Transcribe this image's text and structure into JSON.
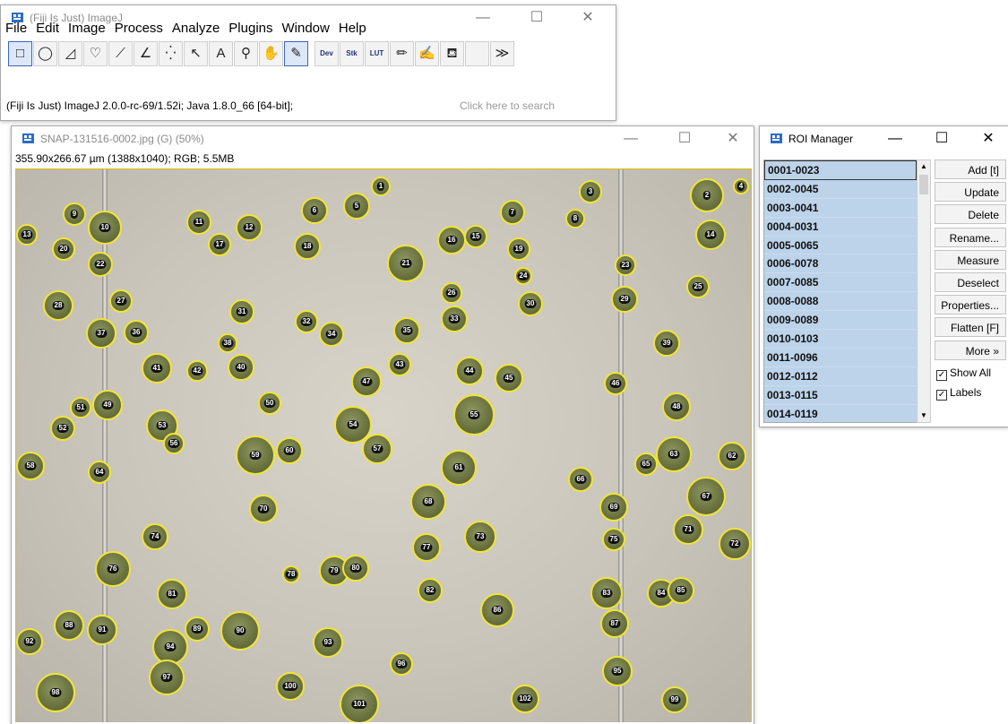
{
  "imagej": {
    "title": "(Fiji Is Just) ImageJ",
    "menu": [
      "File",
      "Edit",
      "Image",
      "Process",
      "Analyze",
      "Plugins",
      "Window",
      "Help"
    ],
    "tools": [
      {
        "name": "rectangle-tool-icon",
        "glyph": "□",
        "selected": true
      },
      {
        "name": "oval-tool-icon",
        "glyph": "◯"
      },
      {
        "name": "polygon-tool-icon",
        "glyph": "◿"
      },
      {
        "name": "freehand-tool-icon",
        "glyph": "♡"
      },
      {
        "name": "line-tool-icon",
        "glyph": "⟋",
        "tri": true
      },
      {
        "name": "angle-tool-icon",
        "glyph": "∠"
      },
      {
        "name": "point-tool-icon",
        "glyph": "⁛",
        "tri": true
      },
      {
        "name": "wand-tool-icon",
        "glyph": "↖"
      },
      {
        "name": "text-tool-icon",
        "glyph": "A"
      },
      {
        "name": "zoom-tool-icon",
        "glyph": "⚲"
      },
      {
        "name": "hand-tool-icon",
        "glyph": "✋"
      },
      {
        "name": "color-picker-icon",
        "glyph": "✎",
        "selected": true
      },
      {
        "name": "dev-menu-icon",
        "glyph": "Dev",
        "txt": true,
        "tri": true
      },
      {
        "name": "stk-menu-icon",
        "glyph": "Stk",
        "txt": true,
        "tri": true
      },
      {
        "name": "lut-menu-icon",
        "glyph": "LUT",
        "txt": true,
        "tri": true
      },
      {
        "name": "pencil-tool-icon",
        "glyph": "✏"
      },
      {
        "name": "brush-tool-icon",
        "glyph": "✍"
      },
      {
        "name": "flood-fill-icon",
        "glyph": "⛾"
      },
      {
        "name": "empty-tool-slot",
        "glyph": ""
      },
      {
        "name": "more-tools-icon",
        "glyph": "≫"
      }
    ],
    "status": "(Fiji Is Just) ImageJ 2.0.0-rc-69/1.52i; Java 1.8.0_66 [64-bit];",
    "search_placeholder": "Click here to search"
  },
  "image_window": {
    "title": "SNAP-131516-0002.jpg (G) (50%)",
    "info": "355.90x266.67 µm (1388x1040); RGB; 5.5MB",
    "cells": [
      [
        "1",
        396,
        8,
        22
      ],
      [
        "2",
        752,
        10,
        38
      ],
      [
        "3",
        628,
        12,
        26
      ],
      [
        "4",
        800,
        10,
        18
      ],
      [
        "5",
        365,
        26,
        30
      ],
      [
        "6",
        318,
        31,
        30
      ],
      [
        "7",
        540,
        34,
        28
      ],
      [
        "8",
        613,
        44,
        22
      ],
      [
        "9",
        52,
        37,
        26
      ],
      [
        "10",
        80,
        46,
        38
      ],
      [
        "11",
        190,
        45,
        28
      ],
      [
        "12",
        245,
        50,
        30
      ],
      [
        "13",
        0,
        61,
        24
      ],
      [
        "14",
        758,
        56,
        34
      ],
      [
        "15",
        500,
        62,
        26
      ],
      [
        "16",
        470,
        63,
        32
      ],
      [
        "17",
        214,
        71,
        26
      ],
      [
        "18",
        310,
        71,
        30
      ],
      [
        "19",
        548,
        76,
        26
      ],
      [
        "20",
        40,
        76,
        26
      ],
      [
        "21",
        414,
        84,
        42
      ],
      [
        "22",
        80,
        92,
        28
      ],
      [
        "23",
        668,
        95,
        24
      ],
      [
        "24",
        556,
        109,
        20
      ],
      [
        "25",
        748,
        118,
        26
      ],
      [
        "26",
        474,
        126,
        24
      ],
      [
        "27",
        104,
        134,
        26
      ],
      [
        "28",
        30,
        135,
        34
      ],
      [
        "29",
        664,
        130,
        30
      ],
      [
        "30",
        560,
        136,
        28
      ],
      [
        "31",
        238,
        145,
        28
      ],
      [
        "32",
        311,
        157,
        26
      ],
      [
        "33",
        474,
        152,
        30
      ],
      [
        "34",
        338,
        170,
        28
      ],
      [
        "35",
        421,
        165,
        30
      ],
      [
        "36",
        120,
        168,
        28
      ],
      [
        "37",
        78,
        166,
        34
      ],
      [
        "38",
        225,
        183,
        22
      ],
      [
        "39",
        711,
        179,
        30
      ],
      [
        "40",
        236,
        206,
        30
      ],
      [
        "41",
        140,
        205,
        34
      ],
      [
        "42",
        190,
        213,
        24
      ],
      [
        "43",
        415,
        205,
        26
      ],
      [
        "44",
        490,
        209,
        32
      ],
      [
        "45",
        534,
        217,
        32
      ],
      [
        "46",
        656,
        226,
        26
      ],
      [
        "47",
        374,
        220,
        34
      ],
      [
        "48",
        721,
        249,
        32
      ],
      [
        "49",
        85,
        246,
        34
      ],
      [
        "50",
        270,
        248,
        26
      ],
      [
        "51",
        60,
        254,
        24
      ],
      [
        "52",
        38,
        275,
        28
      ],
      [
        "53",
        145,
        268,
        36
      ],
      [
        "54",
        355,
        264,
        42
      ],
      [
        "55",
        488,
        251,
        46
      ],
      [
        "56",
        164,
        294,
        24
      ],
      [
        "57",
        386,
        295,
        34
      ],
      [
        "58",
        0,
        315,
        32
      ],
      [
        "59",
        245,
        297,
        44
      ],
      [
        "60",
        290,
        299,
        30
      ],
      [
        "61",
        474,
        313,
        40
      ],
      [
        "62",
        783,
        304,
        32
      ],
      [
        "63",
        714,
        298,
        40
      ],
      [
        "64",
        80,
        325,
        26
      ],
      [
        "65",
        690,
        316,
        26
      ],
      [
        "66",
        616,
        332,
        28
      ],
      [
        "67",
        748,
        343,
        44
      ],
      [
        "68",
        440,
        351,
        40
      ],
      [
        "69",
        651,
        361,
        32
      ],
      [
        "70",
        260,
        363,
        32
      ],
      [
        "71",
        733,
        385,
        34
      ],
      [
        "72",
        784,
        400,
        36
      ],
      [
        "73",
        500,
        392,
        36
      ],
      [
        "74",
        140,
        395,
        30
      ],
      [
        "75",
        654,
        400,
        26
      ],
      [
        "76",
        88,
        426,
        40
      ],
      [
        "77",
        442,
        406,
        32
      ],
      [
        "78",
        297,
        442,
        20
      ],
      [
        "79",
        338,
        431,
        34
      ],
      [
        "80",
        364,
        430,
        30
      ],
      [
        "81",
        157,
        457,
        34
      ],
      [
        "82",
        448,
        456,
        28
      ],
      [
        "83",
        641,
        455,
        36
      ],
      [
        "84",
        704,
        457,
        32
      ],
      [
        "85",
        727,
        455,
        30
      ],
      [
        "86",
        518,
        473,
        38
      ],
      [
        "87",
        652,
        491,
        32
      ],
      [
        "88",
        42,
        492,
        34
      ],
      [
        "89",
        188,
        499,
        28
      ],
      [
        "90",
        228,
        493,
        44
      ],
      [
        "91",
        79,
        497,
        34
      ],
      [
        "92",
        0,
        512,
        30
      ],
      [
        "93",
        331,
        511,
        34
      ],
      [
        "94",
        152,
        513,
        40
      ],
      [
        "95",
        654,
        543,
        34
      ],
      [
        "96",
        417,
        539,
        26
      ],
      [
        "97",
        148,
        547,
        40
      ],
      [
        "98",
        22,
        562,
        44
      ],
      [
        "99",
        720,
        577,
        30
      ],
      [
        "100",
        290,
        561,
        32
      ],
      [
        "101",
        361,
        575,
        44
      ],
      [
        "102",
        552,
        575,
        32
      ]
    ]
  },
  "roi_manager": {
    "title": "ROI Manager",
    "items": [
      "0001-0023",
      "0002-0045",
      "0003-0041",
      "0004-0031",
      "0005-0065",
      "0006-0078",
      "0007-0085",
      "0008-0088",
      "0009-0089",
      "0010-0103",
      "0011-0096",
      "0012-0112",
      "0013-0115",
      "0014-0119"
    ],
    "buttons": [
      "Add [t]",
      "Update",
      "Delete",
      "Rename...",
      "Measure",
      "Deselect",
      "Properties...",
      "Flatten [F]",
      "More »"
    ],
    "show_all_label": "Show All",
    "labels_label": "Labels",
    "show_all_checked": true,
    "labels_checked": true
  },
  "window_controls": {
    "minimize": "—",
    "maximize": "☐",
    "close": "✕"
  }
}
